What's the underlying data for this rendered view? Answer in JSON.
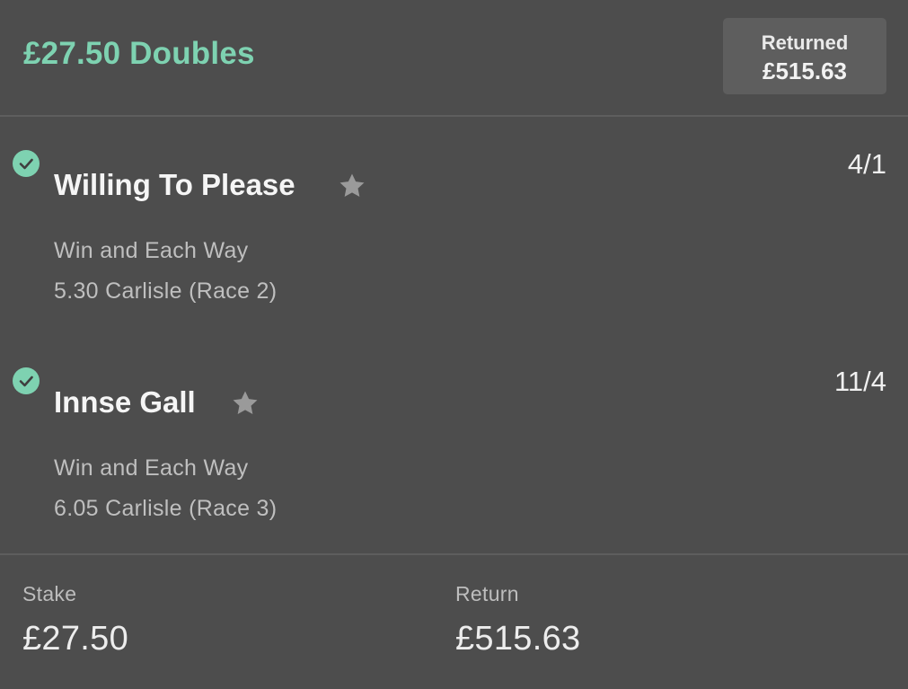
{
  "bet": {
    "title": "£27.50 Doubles",
    "returned_label": "Returned",
    "returned_value": "£515.63"
  },
  "selections": [
    {
      "status": "won",
      "status_icon": "check-circle-icon",
      "name": "Willing To Please",
      "favourite_icon": "star-icon",
      "odds": "4/1",
      "market": "Win and Each Way",
      "event": "5.30 Carlisle (Race 2)"
    },
    {
      "status": "won",
      "status_icon": "check-circle-icon",
      "name": "Innse Gall",
      "favourite_icon": "star-icon",
      "odds": "11/4",
      "market": "Win and Each Way",
      "event": "6.05 Carlisle (Race 3)"
    }
  ],
  "summary": {
    "stake_label": "Stake",
    "stake_value": "£27.50",
    "return_label": "Return",
    "return_value": "£515.63"
  },
  "colors": {
    "background": "#4d4d4d",
    "accent_green": "#7ed2b1",
    "panel": "#5e5e5e",
    "secondary_text": "#bfbfbf",
    "star": "#9a9a9a"
  }
}
